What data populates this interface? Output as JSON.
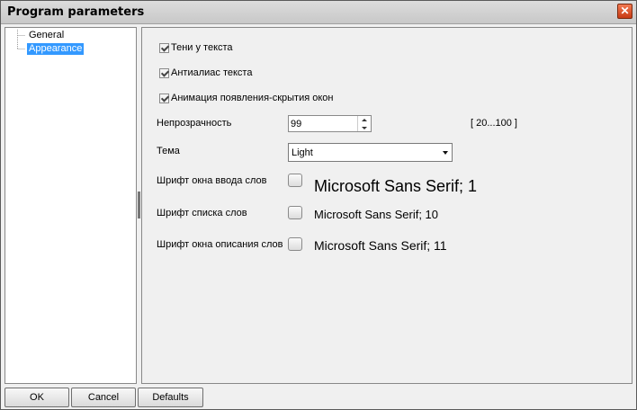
{
  "window": {
    "title": "Program parameters"
  },
  "tree": {
    "items": [
      {
        "label": "General"
      },
      {
        "label": "Appearance",
        "selected": true
      }
    ]
  },
  "options": {
    "shadow": {
      "label": "Тени у текста",
      "checked": true
    },
    "antialias": {
      "label": "Антиалиас текста",
      "checked": true
    },
    "animation": {
      "label": "Анимация появления-скрытия окон",
      "checked": true
    }
  },
  "opacity": {
    "label": "Непрозрачность",
    "value": "99",
    "range": "[ 20...100 ]"
  },
  "theme": {
    "label": "Тема",
    "value": "Light"
  },
  "fonts": {
    "input": {
      "label": "Шрифт окна ввода слов",
      "sample": "Microsoft Sans Serif; 1"
    },
    "list": {
      "label": "Шрифт списка слов",
      "sample": "Microsoft Sans Serif; 10"
    },
    "description": {
      "label": "Шрифт окна описания слов",
      "sample": "Microsoft Sans Serif; 11"
    }
  },
  "buttons": {
    "ok": "OK",
    "cancel": "Cancel",
    "defaults": "Defaults"
  }
}
